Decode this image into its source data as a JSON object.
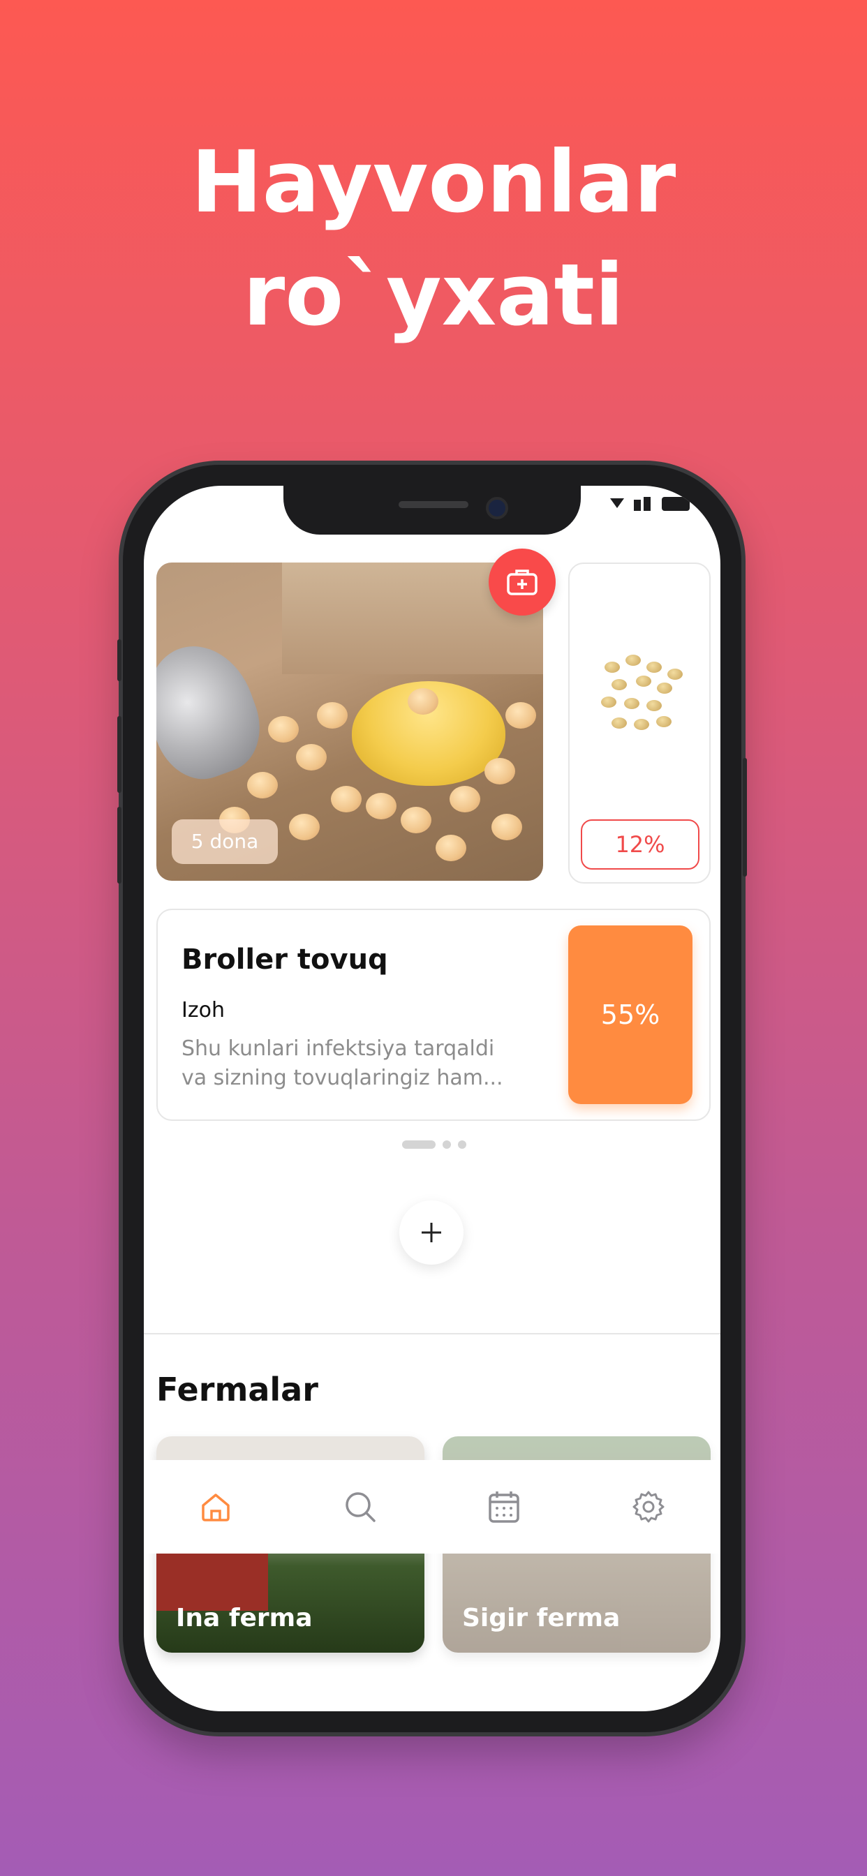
{
  "headline": {
    "line1": "Hayvonlar",
    "line2": "ro`yxati"
  },
  "colors": {
    "accent": "#ff8b40",
    "danger": "#f04a4a",
    "med_button": "#f94a4a"
  },
  "animal_card": {
    "count_badge": "5 dona",
    "side_card_percent": "12%",
    "title": "Broller tovuq",
    "note_label": "Izoh",
    "note_line1": "Shu kunlari infektsiya tarqaldi",
    "note_line2": "va sizning tovuqlaringiz ham...",
    "progress": "55%"
  },
  "carousel": {
    "pages": 3,
    "active": 0
  },
  "farms": {
    "title": "Fermalar",
    "items": [
      {
        "name": "Ina ferma"
      },
      {
        "name": "Sigir ferma"
      }
    ]
  },
  "nav": {
    "items": [
      {
        "icon": "home-icon",
        "active": true
      },
      {
        "icon": "search-icon",
        "active": false
      },
      {
        "icon": "calendar-icon",
        "active": false
      },
      {
        "icon": "settings-icon",
        "active": false
      }
    ]
  }
}
